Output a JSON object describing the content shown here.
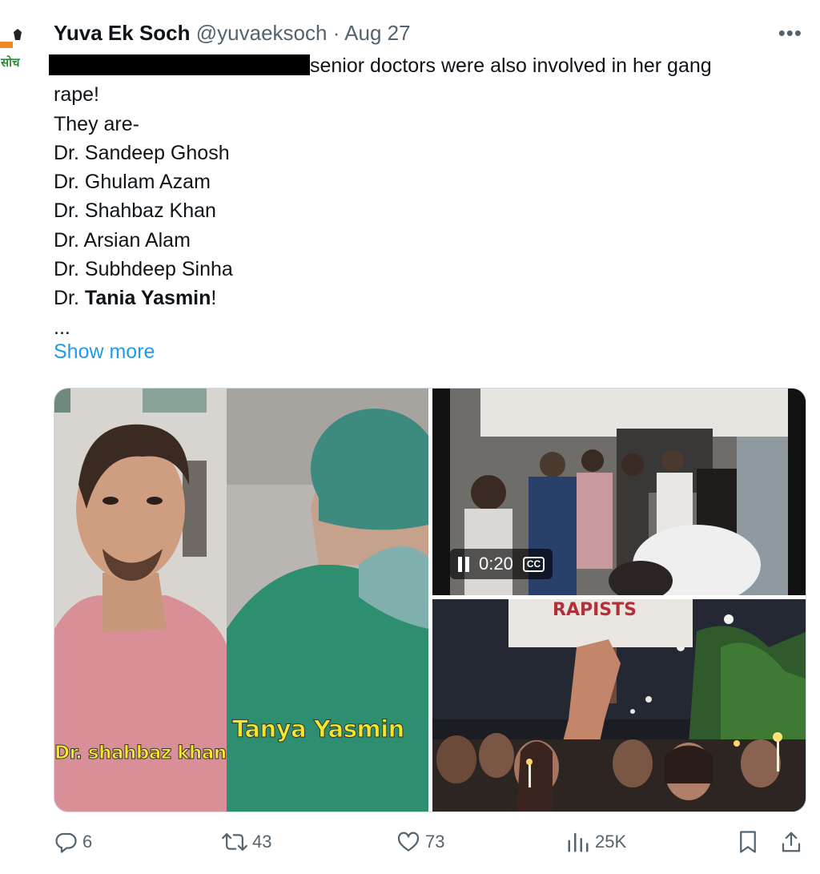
{
  "tweet": {
    "author_name": "Yuva Ek Soch",
    "author_handle": "@yuvaeksoch",
    "separator": "·",
    "date": "Aug 27",
    "more_label": "•••",
    "avatar_text": "सोच",
    "text": {
      "line1_after_redaction": "senior doctors were also involved in her gang",
      "line2": "rape!",
      "line3": "They are-",
      "names": [
        "Dr. Sandeep Ghosh",
        "Dr. Ghulam Azam",
        "Dr. Shahbaz Khan",
        "Dr. Arsian Alam",
        "Dr. Subhdeep Sinha"
      ],
      "last_prefix": "Dr. ",
      "last_bold": "Tania Yasmin",
      "last_suffix": "!",
      "ellipsis": "..."
    },
    "show_more": "Show more",
    "media": {
      "image1_caption_left": "Dr. shahbaz khan",
      "image1_caption_right": "Tanya Yasmin",
      "video_time": "0:20",
      "video_cc": "CC",
      "image3_sign_text": "RAPISTS"
    },
    "actions": {
      "replies": "6",
      "reposts": "43",
      "likes": "73",
      "views": "25K"
    }
  },
  "colors": {
    "link": "#1d9bf0",
    "secondary_text": "#536471",
    "caption_yellow": "#f4e62a"
  },
  "icons": [
    "reply-icon",
    "repost-icon",
    "like-icon",
    "views-icon",
    "bookmark-icon",
    "share-icon",
    "more-icon",
    "pause-icon",
    "cc-icon"
  ]
}
